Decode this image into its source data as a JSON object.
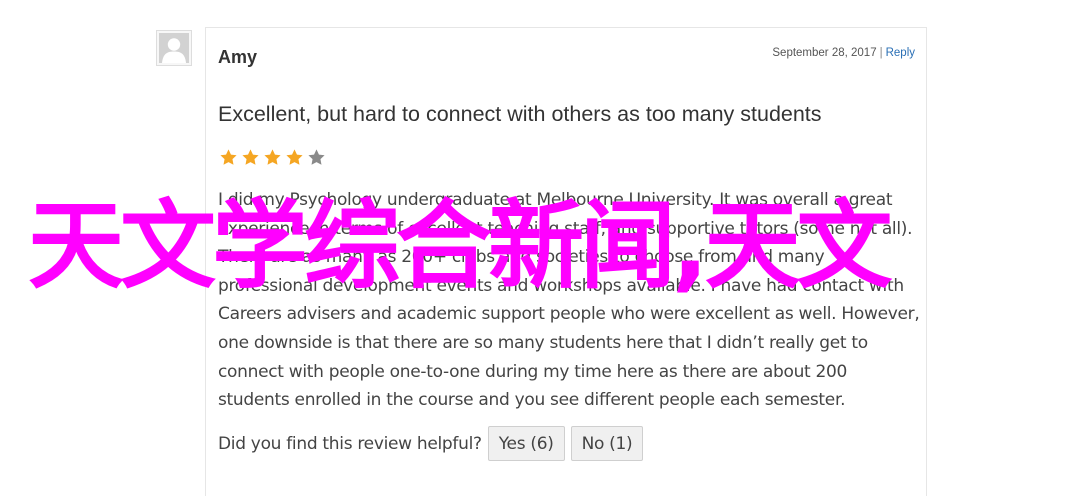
{
  "review": {
    "author": "Amy",
    "date": "September 28, 2017",
    "separator": "|",
    "reply_label": "Reply",
    "title": "Excellent, but hard to connect with others as too many students",
    "rating": 4,
    "rating_max": 5,
    "star_color_filled": "#f5a623",
    "star_color_empty": "#8a8a8a",
    "body_lines": [
      "I did my Psychology undergraduate at Melbourne University. It was overall a great",
      "experience in terms of excellent teaching staff, and supportive tutors (some not all).",
      "There are as many as 200+ clubs and societies to choose from and many",
      "professional development events and workshops available. I have had contact with",
      "Careers advisers and academic support people who were excellent as well. However,",
      "one downside is that there are so many students here that I didn’t really get to",
      "connect with people one-to-one during my time here as there are about 200",
      "students enrolled in the course and you see different people each semester."
    ],
    "helpful_prompt": "Did you find this review helpful?",
    "yes_label": "Yes (6)",
    "no_label": "No (1)"
  },
  "overlay": {
    "text": "天文学综合新闻,天文",
    "color": "#ff00ff"
  },
  "icons": {
    "avatar": "default-user-avatar-icon",
    "star": "star-icon"
  }
}
